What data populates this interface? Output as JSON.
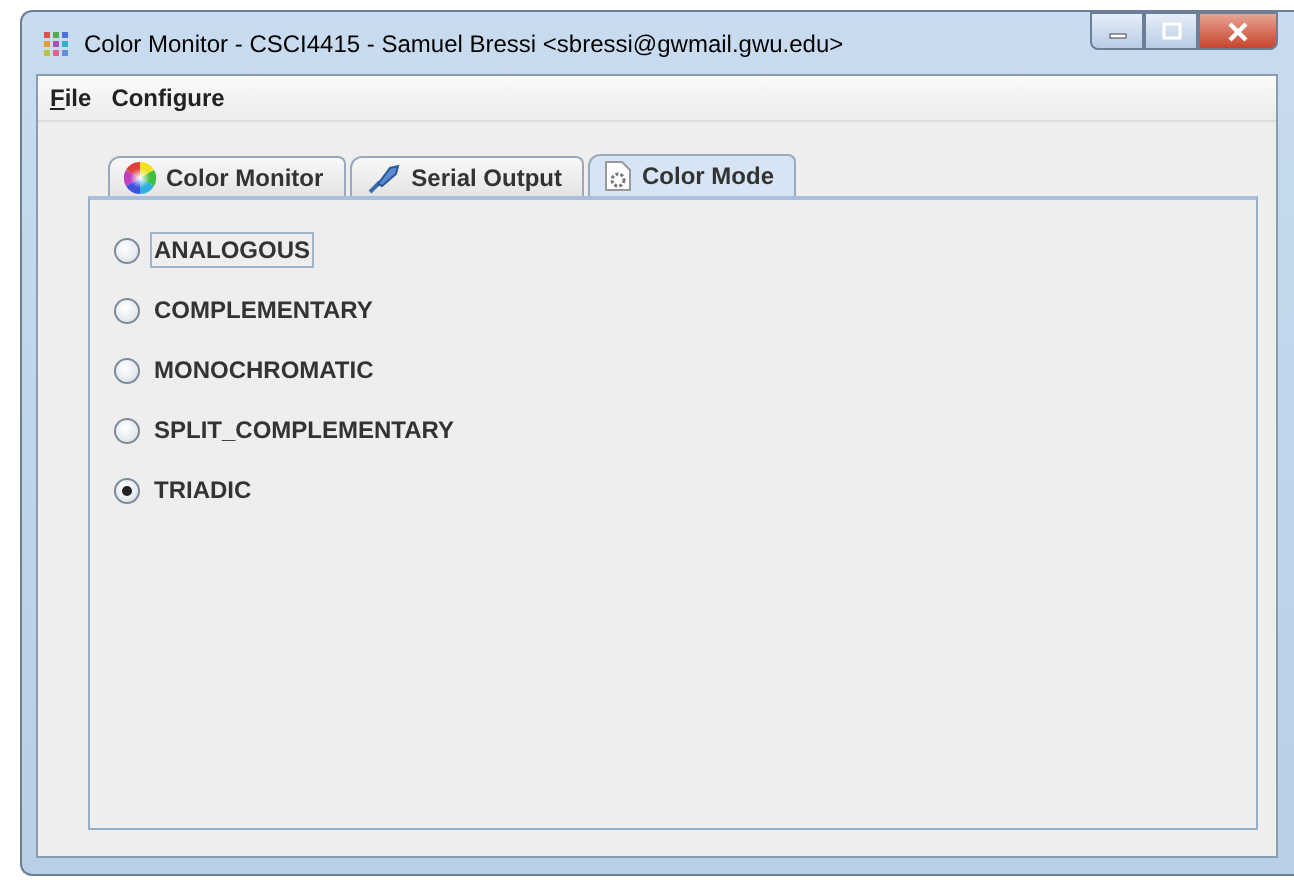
{
  "window": {
    "title": "Color Monitor - CSCI4415 - Samuel Bressi <sbressi@gwmail.gwu.edu>"
  },
  "menu": [
    {
      "label": "File",
      "mnemonic": true
    },
    {
      "label": "Configure",
      "mnemonic": false
    }
  ],
  "tabs": [
    {
      "label": "Color Monitor",
      "kind": "wheel",
      "selected": false
    },
    {
      "label": "Serial Output",
      "kind": "plug",
      "selected": false
    },
    {
      "label": "Color Mode",
      "kind": "gear",
      "selected": true
    }
  ],
  "options": [
    {
      "label": "ANALOGOUS",
      "selected": false,
      "focused": true
    },
    {
      "label": "COMPLEMENTARY",
      "selected": false,
      "focused": false
    },
    {
      "label": "MONOCHROMATIC",
      "selected": false,
      "focused": false
    },
    {
      "label": "SPLIT_COMPLEMENTARY",
      "selected": false,
      "focused": false
    },
    {
      "label": "TRIADIC",
      "selected": true,
      "focused": false
    }
  ]
}
